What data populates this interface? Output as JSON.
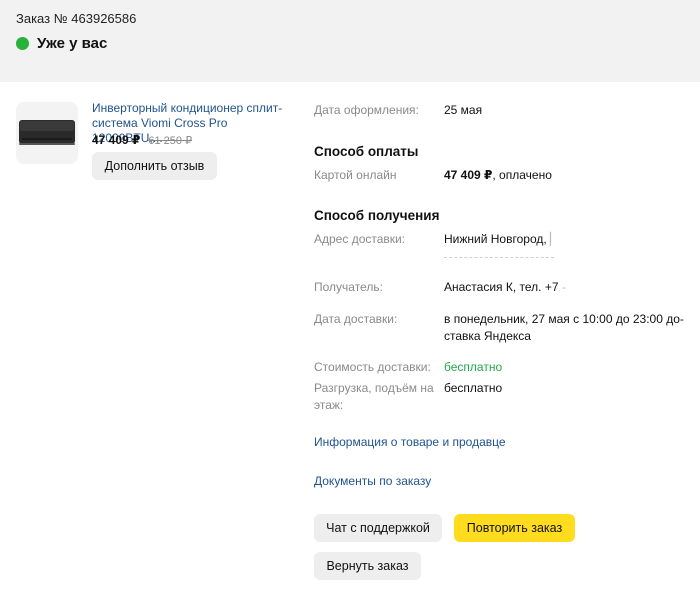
{
  "order": {
    "number": "Заказ № 463926586",
    "status": "Уже у вас",
    "status_color": "#27b33b"
  },
  "product": {
    "title": "Инверторный кондиционер сплит-система Viomi Cross Pro 12000BTU,...",
    "price": "47 409 ₽",
    "old_price": "61 250 ₽",
    "review_button": "Дополнить отзыв",
    "image_icon": "air-conditioner-icon"
  },
  "details": {
    "order_date_label": "Дата оформления:",
    "order_date_value": "25 мая",
    "payment_title": "Способ оплаты",
    "payment_label": "Картой онлайн",
    "payment_amount": "47 409 ₽",
    "payment_status": ", оплачено",
    "delivery_title": "Способ получения",
    "address_label": "Адрес доставки:",
    "address_value": "Нижний Новгород, ",
    "recipient_label": "Получатель:",
    "recipient_value": "Анастасия К, тел. +7",
    "delivery_date_label": "Дата доставки:",
    "delivery_date_value_line1": "в понедельник, 27 мая с 10:00 до 23:00 до-",
    "delivery_date_value_line2": "ставка Яндекса",
    "delivery_cost_label": "Стоимость доставки:",
    "delivery_cost_value": "бесплатно",
    "unloading_label_line1": "Разгрузка, подъём на",
    "unloading_label_line2": "этаж:",
    "unloading_value": "бесплатно"
  },
  "links": {
    "product_info": "Информация о товаре и продавце",
    "documents": "Документы по заказу"
  },
  "actions": {
    "support_chat": "Чат с поддержкой",
    "repeat_order": "Повторить заказ",
    "return_order": "Вернуть заказ"
  },
  "colors": {
    "accent_yellow": "#ffdc1e",
    "link_blue": "#21548c",
    "free_green": "#24a84a"
  }
}
